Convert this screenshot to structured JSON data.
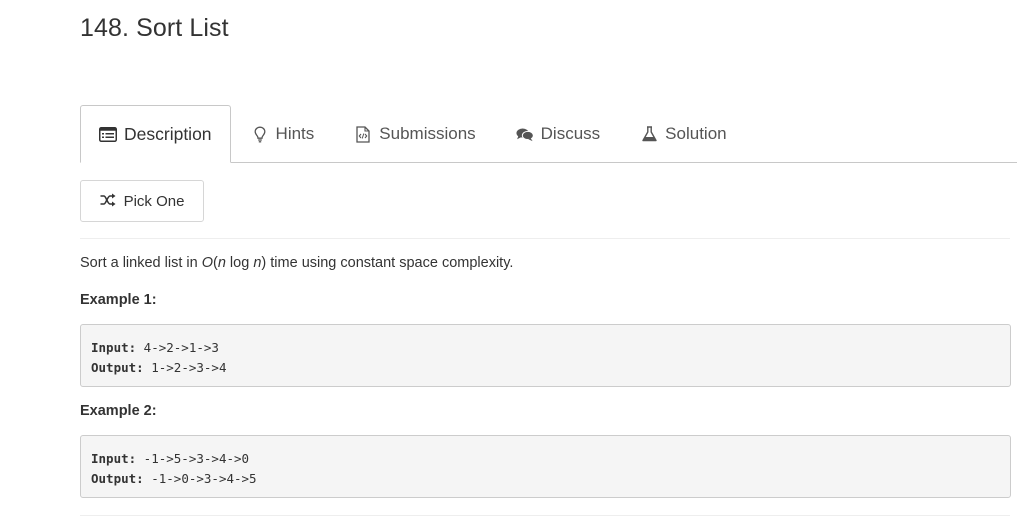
{
  "problem": {
    "title": "148. Sort List"
  },
  "tabs": [
    {
      "label": "Description",
      "icon": "list-alt-icon",
      "active": true
    },
    {
      "label": "Hints",
      "icon": "lightbulb-icon",
      "active": false
    },
    {
      "label": "Submissions",
      "icon": "code-file-icon",
      "active": false
    },
    {
      "label": "Discuss",
      "icon": "comments-icon",
      "active": false
    },
    {
      "label": "Solution",
      "icon": "flask-icon",
      "active": false
    }
  ],
  "pick_one": {
    "label": "Pick One",
    "icon": "shuffle-icon"
  },
  "description": {
    "prefix": "Sort a linked list in ",
    "complexity_O": "O",
    "complexity_open": "(",
    "complexity_n1": "n",
    "complexity_log": " log ",
    "complexity_n2": "n",
    "complexity_close": ")",
    "suffix": " time using constant space complexity."
  },
  "examples": [
    {
      "label": "Example 1:",
      "input_label": "Input:",
      "input_value": " 4->2->1->3",
      "output_label": "Output:",
      "output_value": " 1->2->3->4"
    },
    {
      "label": "Example 2:",
      "input_label": "Input:",
      "input_value": " -1->5->3->4->0",
      "output_label": "Output:",
      "output_value": " -1->0->3->4->5"
    }
  ],
  "colors": {
    "text": "#333333",
    "tab_text": "#555555",
    "border": "#c8c8c8",
    "code_bg": "#f5f5f5"
  }
}
